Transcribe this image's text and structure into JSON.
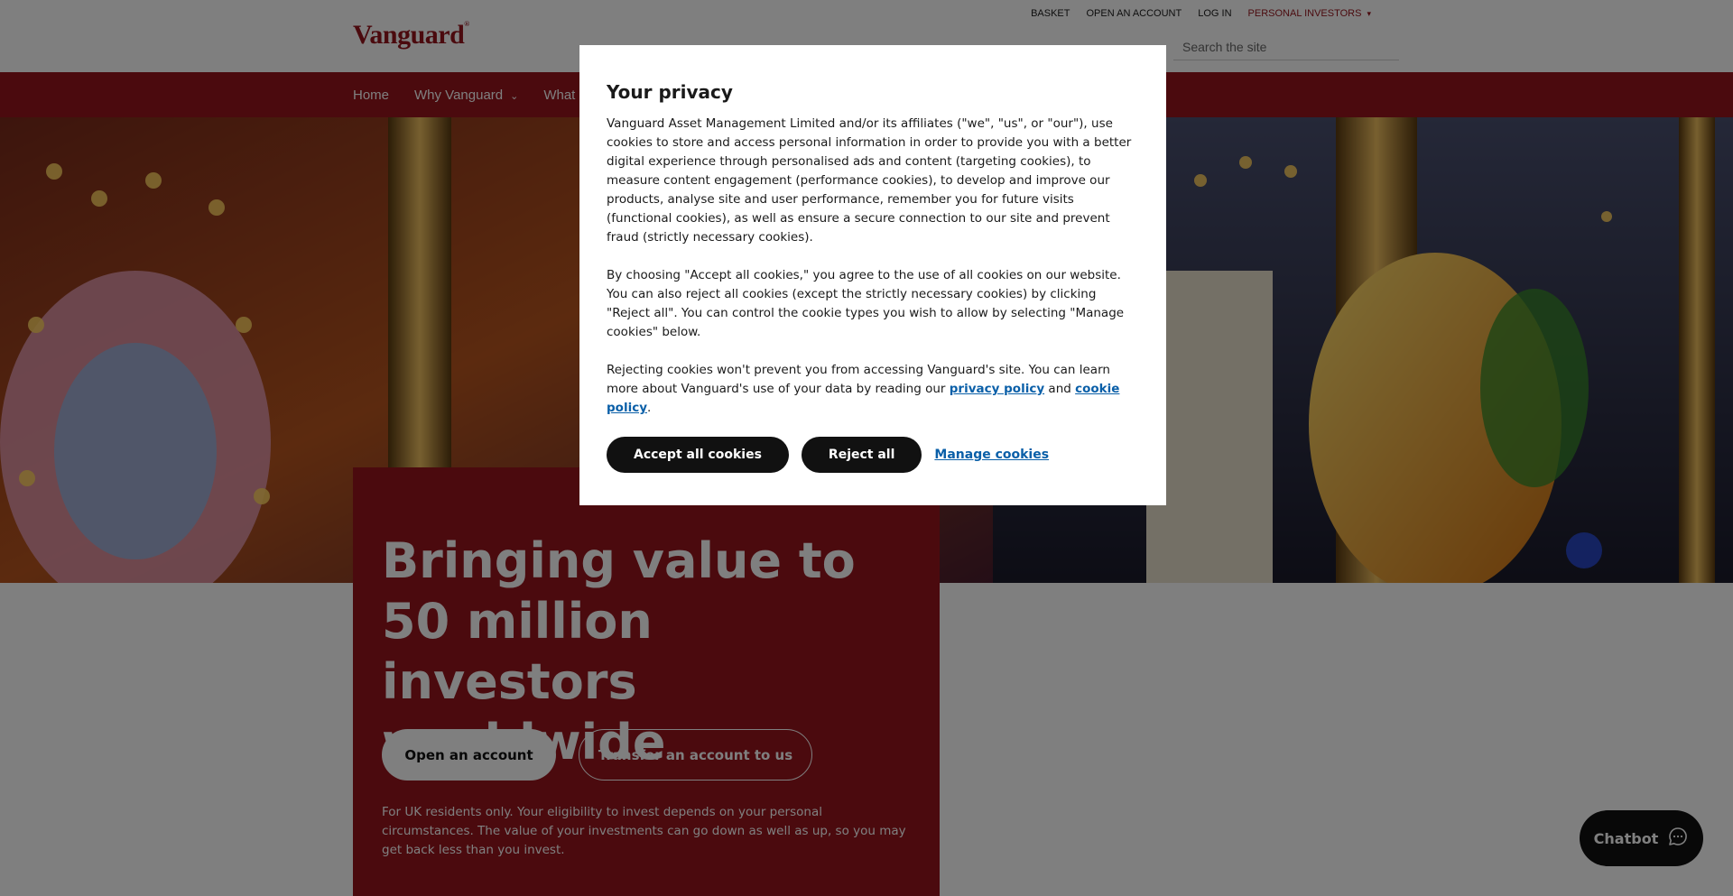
{
  "header": {
    "brand": "Vanguard",
    "utility_links": [
      "BASKET",
      "OPEN AN ACCOUNT",
      "LOG IN"
    ],
    "audience": "PERSONAL INVESTORS",
    "search_placeholder": "Search the site"
  },
  "nav": {
    "home": "Home",
    "why_vanguard": "Why Vanguard",
    "what": "What"
  },
  "hero": {
    "headline": "Bringing value to 50 million investors worldwide",
    "primary_button": "Open an account",
    "secondary_button": "Transfer an account to us",
    "disclaimer": "For UK residents only. Your eligibility to invest depends on your personal circumstances. The value of your investments can go down as well as up, so you may get back less than you invest."
  },
  "privacy_modal": {
    "title": "Your privacy",
    "paragraph1": "Vanguard Asset Management Limited and/or its affiliates (\"we\", \"us\", or \"our\"), use cookies to store and access personal information in order to provide you with a better digital experience through personalised ads and content (targeting cookies), to measure content engagement (performance cookies), to develop and improve our products, analyse site and user performance, remember you for future visits (functional cookies), as well as ensure a secure connection to our site and prevent fraud (strictly necessary cookies).",
    "paragraph2": "By choosing \"Accept all cookies,\" you agree to the use of all cookies on our website. You can also reject all cookies (except the strictly necessary cookies) by clicking \"Reject all\". You can control the cookie types you wish to allow by selecting \"Manage cookies\" below.",
    "paragraph3_start": "Rejecting cookies won't prevent you from accessing Vanguard's site. You can learn more about Vanguard's use of your data by reading our",
    "privacy_link": "privacy policy",
    "and": "and",
    "cookie_link": "cookie policy",
    "period": ".",
    "accept_button": "Accept all cookies",
    "reject_button": "Reject all",
    "manage_link": "Manage cookies"
  },
  "chatbot": {
    "label": "Chatbot",
    "icon": "chat-bubble-icon"
  },
  "colors": {
    "brand_red": "#96151d",
    "link_blue": "#0a5fa8",
    "button_black": "#111111"
  }
}
